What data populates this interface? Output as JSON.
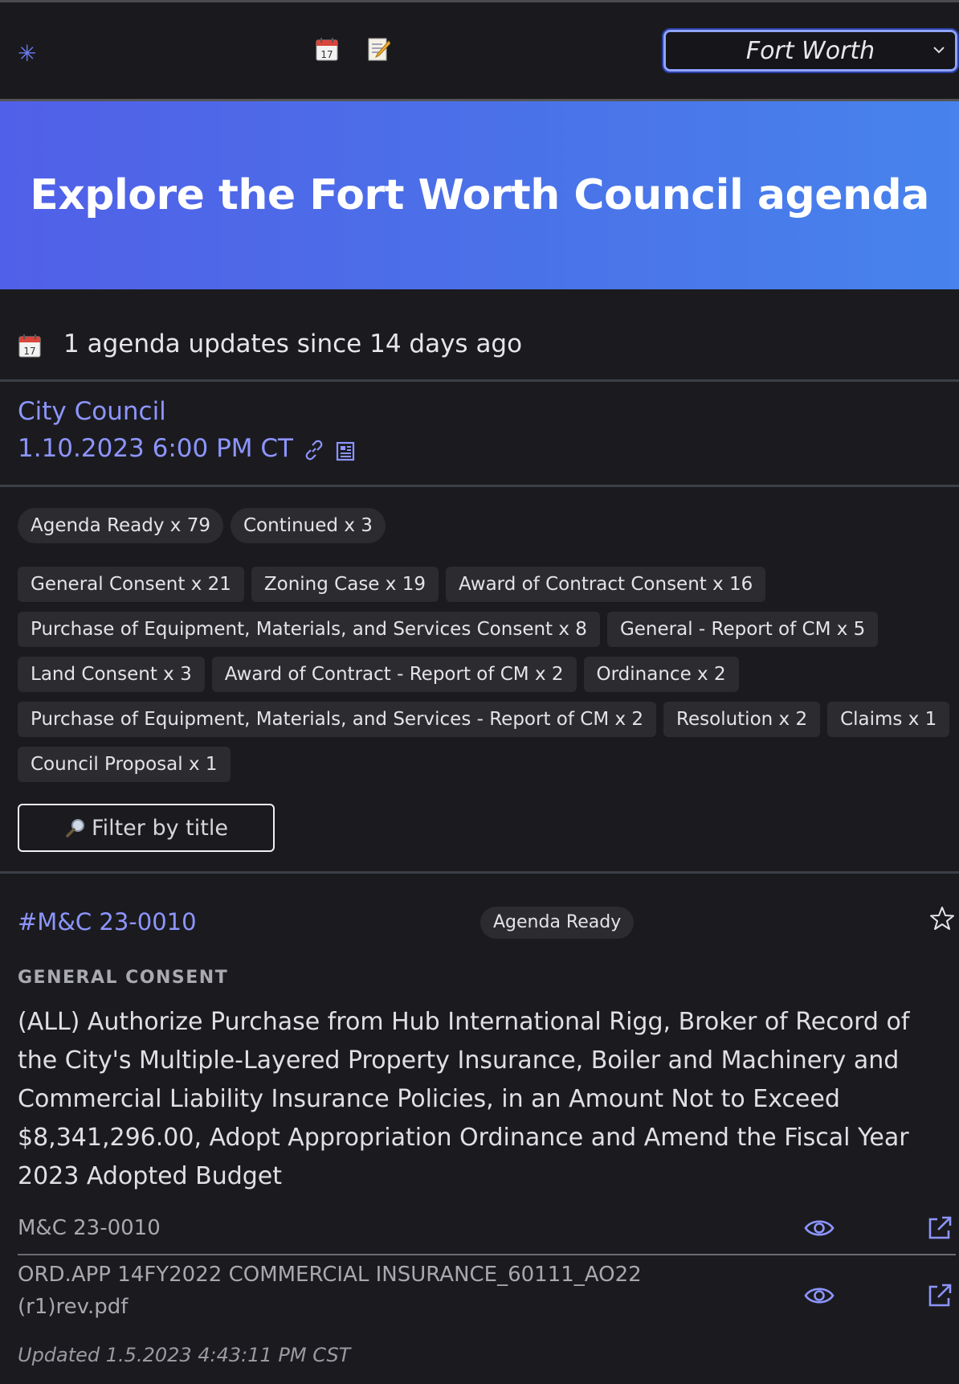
{
  "header": {
    "logo_icon": "asterisk-logo-icon",
    "nav_icons": [
      "calendar-icon",
      "memo-icon"
    ],
    "city_select": {
      "value": "Fort Worth"
    }
  },
  "hero": {
    "title": "Explore the Fort Worth Council agenda"
  },
  "updates": {
    "text": "1 agenda updates since 14 days ago"
  },
  "meeting": {
    "body": "City Council",
    "datetime": "1.10.2023 6:00 PM CT"
  },
  "status_tags": [
    "Agenda Ready x 79",
    "Continued x 3"
  ],
  "category_tags": [
    "General Consent x 21",
    "Zoning Case x 19",
    "Award of Contract Consent x 16",
    "Purchase of Equipment, Materials, and Services Consent x 8",
    "General - Report of CM x 5",
    "Land Consent x 3",
    "Award of Contract - Report of CM x 2",
    "Ordinance x 2",
    "Purchase of Equipment, Materials, and Services - Report of CM x 2",
    "Resolution x 2",
    "Claims x 1",
    "Council Proposal x 1"
  ],
  "filter": {
    "label": "Filter by title"
  },
  "item": {
    "number": "#M&C 23-0010",
    "status": "Agenda Ready",
    "category": "GENERAL CONSENT",
    "title": "(ALL) Authorize Purchase from Hub International Rigg, Broker of Record of the City's Multiple-Layered Property Insurance, Boiler and Machinery and Commercial Liability Insurance Policies, in an Amount Not to Exceed $8,341,296.00, Adopt Appropriation Ordinance and Amend the Fiscal Year 2023 Adopted Budget",
    "attachments": [
      {
        "name": "M&C 23-0010"
      },
      {
        "name": "ORD.APP 14FY2022 COMMERCIAL INSURANCE_60111_AO22 (r1)rev.pdf"
      }
    ],
    "updated": "Updated 1.5.2023 4:43:11 PM CST"
  },
  "colors": {
    "background": "#1b1b1f",
    "accent": "#8d95ff",
    "hero_gradient_start": "#5160e8",
    "hero_gradient_end": "#4783ec",
    "tag_bg": "#2b2b30"
  }
}
